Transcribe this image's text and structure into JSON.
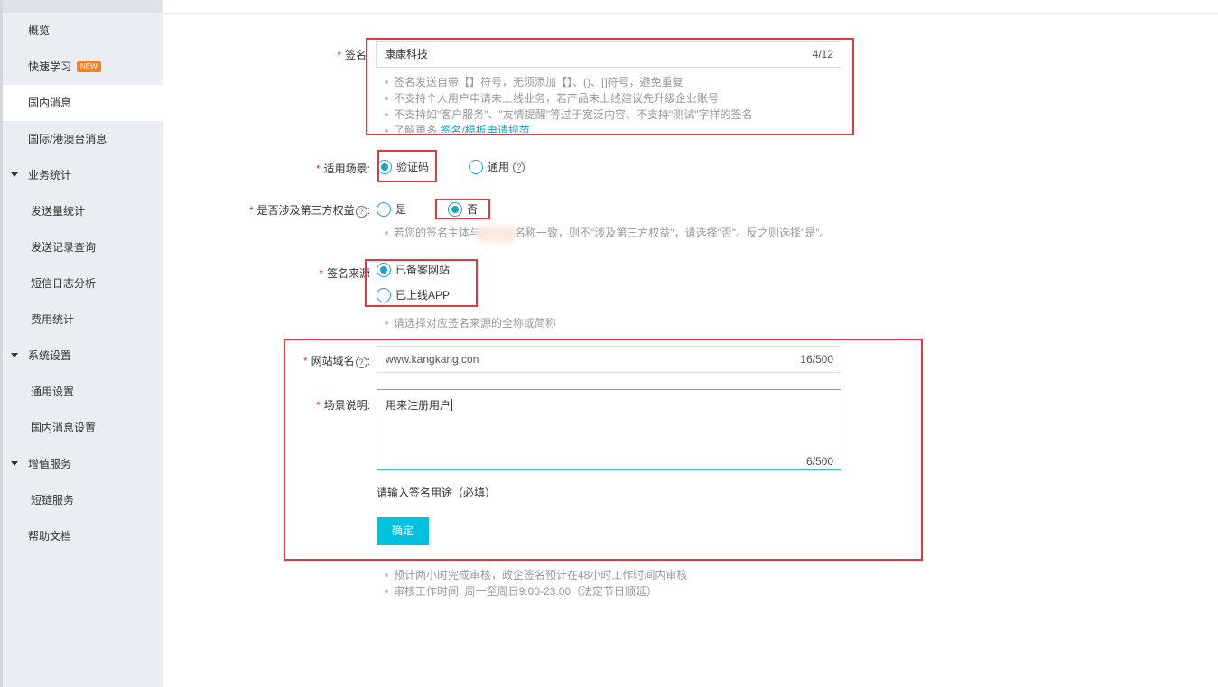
{
  "sidebar": {
    "items": [
      {
        "label": "概览"
      },
      {
        "label": "快速学习",
        "badge": "NEW"
      },
      {
        "label": "国内消息"
      },
      {
        "label": "国际/港澳台消息"
      },
      {
        "label": "业务统计"
      },
      {
        "label": "发送量统计"
      },
      {
        "label": "发送记录查询"
      },
      {
        "label": "短信日志分析"
      },
      {
        "label": "费用统计"
      },
      {
        "label": "系统设置"
      },
      {
        "label": "通用设置"
      },
      {
        "label": "国内消息设置"
      },
      {
        "label": "增值服务"
      },
      {
        "label": "短链服务"
      },
      {
        "label": "帮助文档"
      }
    ]
  },
  "form": {
    "required_mark": "*",
    "help_mark": "?",
    "signature": {
      "label": "签名",
      "value": "康康科技",
      "count": "4/12",
      "tips": [
        "签名发送自带【】符号，无须添加【】、()、[]符号，避免重复",
        "不支持个人用户申请未上线业务，若产品未上线建议先升级企业账号",
        "不支持如\"客户服务\"、\"友情提醒\"等过于宽泛内容、不支持\"测试\"字样的签名"
      ],
      "more_prefix": "了解更多",
      "more_link": "签名/模板申请规范"
    },
    "scenario": {
      "label": "适用场景:",
      "options": [
        "验证码",
        "通用"
      ],
      "selected": "验证码"
    },
    "third_party": {
      "label": "是否涉及第三方权益",
      "colon": ":",
      "options": [
        "是",
        "否"
      ],
      "selected": "否",
      "tip_part1": "若您的签名主体与",
      "tip_part2": "名称一致，则不\"涉及第三方权益\"，请选择\"否\"。反之则选择\"是\"。"
    },
    "source": {
      "label": "签名来源",
      "options": [
        "已备案网站",
        "已上线APP"
      ],
      "selected": "已备案网站",
      "tip": "请选择对应签名来源的全称或简称"
    },
    "domain": {
      "label": "网站域名",
      "colon": ":",
      "value": "www.kangkang.con",
      "count": "16/500"
    },
    "description": {
      "label": "场景说明:",
      "value": "用来注册用户",
      "count": "6/500",
      "hint": "请输入签名用途（必填）"
    },
    "submit_label": "确定",
    "footer_tips": [
      "预计两小时完成审核，政企签名预计在48小时工作时间内审核",
      "审核工作时间: 周一至周日9:00-23:00（法定节日顺延）"
    ]
  },
  "colors": {
    "accent": "#1ba3c6",
    "primary_button": "#00c1de",
    "required": "#e0393e",
    "highlight_box": "#e0393e",
    "badge": "#f7811e"
  }
}
